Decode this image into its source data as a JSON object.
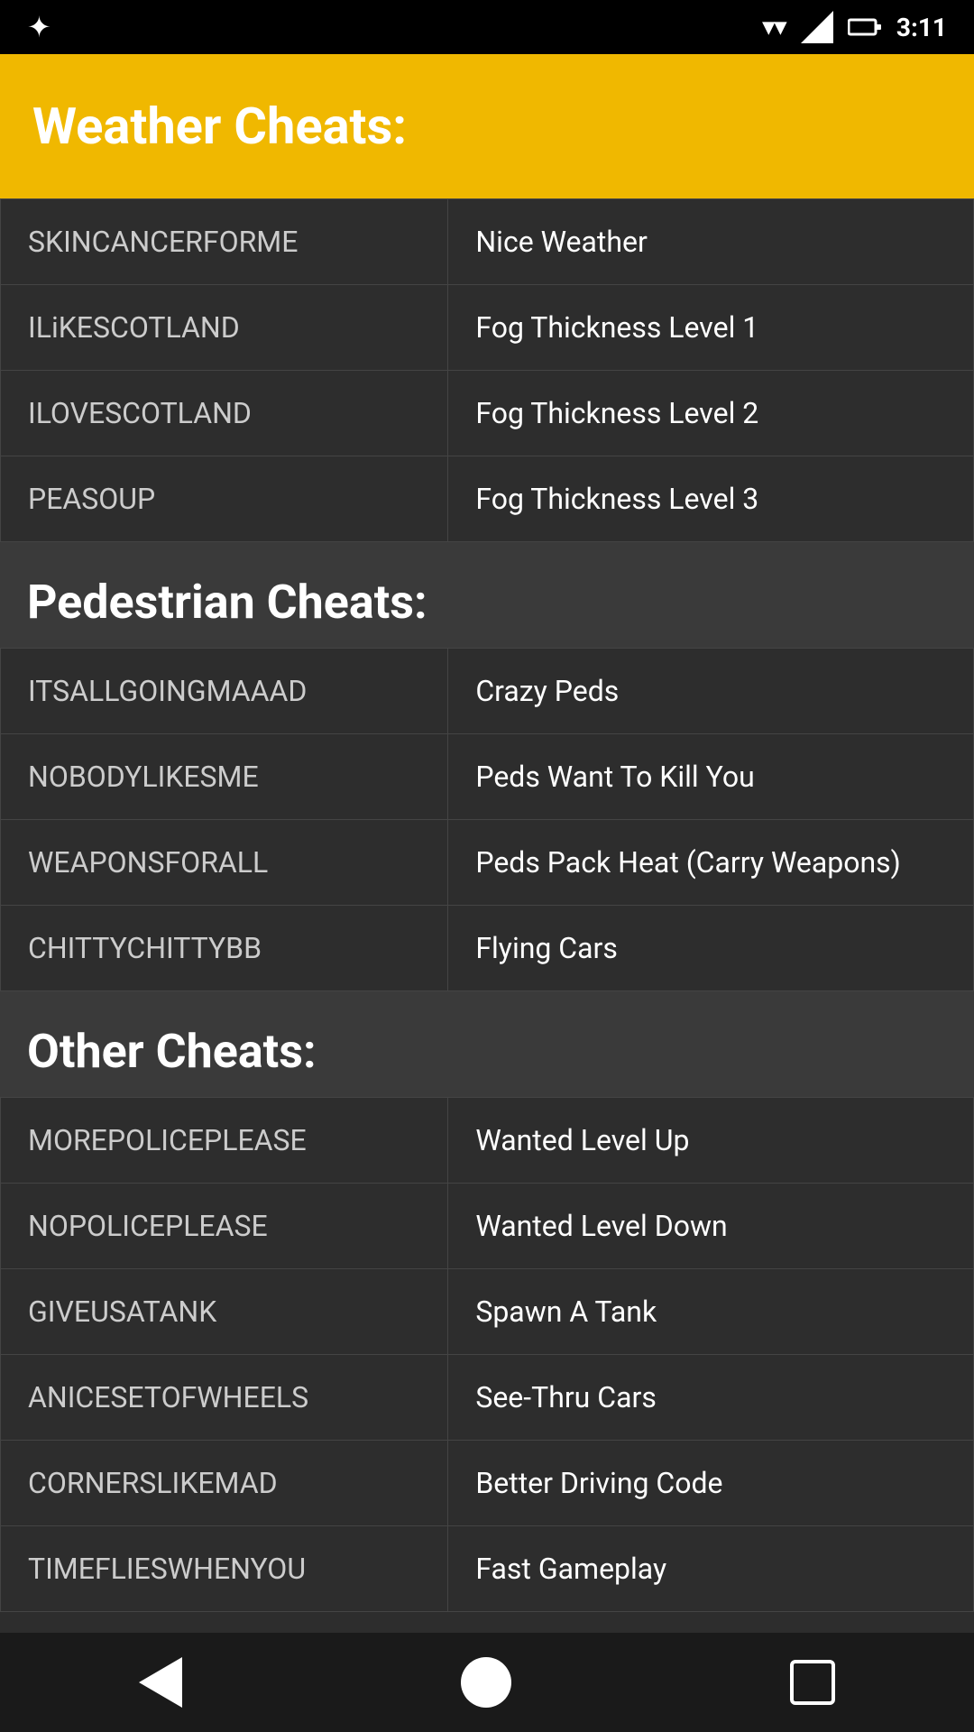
{
  "statusBar": {
    "time": "3:11",
    "dotsIcon": "✦"
  },
  "sections": [
    {
      "id": "weather",
      "type": "header",
      "title": "Weather Cheats:"
    },
    {
      "id": "weather-cheats",
      "type": "table",
      "rows": [
        {
          "code": "SKINCANCERFORME",
          "effect": "Nice Weather"
        },
        {
          "code": "ILiKESCOTLAND",
          "effect": "Fog Thickness Level 1"
        },
        {
          "code": "ILOVESCOTLAND",
          "effect": "Fog Thickness Level 2"
        },
        {
          "code": "PEASOUP",
          "effect": "Fog Thickness Level 3"
        }
      ]
    },
    {
      "id": "pedestrian",
      "type": "section-header",
      "title": "Pedestrian Cheats:"
    },
    {
      "id": "pedestrian-cheats",
      "type": "table",
      "rows": [
        {
          "code": "ITSALLGOINGMAAAD",
          "effect": "Crazy Peds"
        },
        {
          "code": "NOBODYLIKESME",
          "effect": "Peds Want To Kill You"
        },
        {
          "code": "WEAPONSFORALL",
          "effect": "Peds Pack Heat (Carry Weapons)"
        },
        {
          "code": "CHITTYCHITTYBB",
          "effect": "Flying Cars"
        }
      ]
    },
    {
      "id": "other",
      "type": "section-header",
      "title": "Other Cheats:"
    },
    {
      "id": "other-cheats",
      "type": "table",
      "rows": [
        {
          "code": "MOREPOLICEPLEASE",
          "effect": "Wanted Level Up"
        },
        {
          "code": "NOPOLICEPLEASE",
          "effect": "Wanted Level Down"
        },
        {
          "code": "GIVEUSATANK",
          "effect": "Spawn A Tank"
        },
        {
          "code": "ANICESETOFWHEELS",
          "effect": "See-Thru Cars"
        },
        {
          "code": "CORNERSLIKEMAD",
          "effect": "Better Driving Code"
        },
        {
          "code": "TIMEFLIESWHENYOU",
          "effect": "Fast Gameplay"
        }
      ]
    }
  ],
  "navBar": {
    "backLabel": "back",
    "homeLabel": "home",
    "squareLabel": "recents"
  }
}
